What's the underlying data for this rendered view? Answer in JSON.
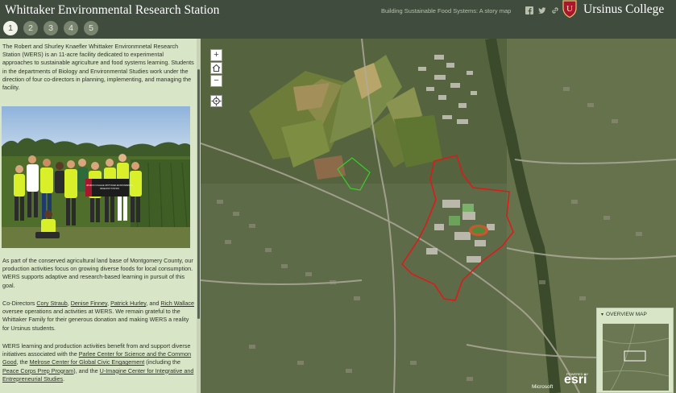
{
  "header": {
    "title": "Whittaker Environmental Research Station",
    "tabs": [
      "1",
      "2",
      "3",
      "4",
      "5"
    ],
    "active_tab": "1",
    "tagline": "Building Sustainable Food Systems: A story map",
    "share_icons": [
      "facebook-icon",
      "twitter-icon",
      "link-icon"
    ],
    "college_name": "Ursinus College"
  },
  "panel": {
    "intro": "The Robert and Shurley Knaefler Whittaker Environmnetal Research Station (WERS) is an 11-acre facility dedicated to experimental approaches to sustainable agriculture and food systems learning. Students in the departments of Biology and Environmental Studies work under the direction of four co-directors in planning, implementing, and managing the facility.",
    "photo_sign_line1": "URSINUS COLLEGE WHITTAKER ENVIRONMENTAL",
    "photo_sign_line2": "RESEARCH STATION",
    "para2": "As part of the conserved agricultural land base of Montgomery County, our production activities focus on growing diverse foods for local consumption. WERS supports adaptive and research-based learning in pursuit of this goal.",
    "para3": {
      "prefix": "Co-Directors ",
      "link1": "Cory Straub",
      "sep1": ", ",
      "link2": "Denise Finney",
      "sep2": ", ",
      "link3": "Patrick Hurley",
      "sep3": ", and ",
      "link4": "Rich Wallace",
      "suffix": " oversee operations and activities at WERS. We remain grateful to the Whittaker Family for their generous donation and making WERS a reality for Ursinus students."
    },
    "para4": {
      "prefix": "WERS learning and production activities benefit from and support diverse initiatives associated with the ",
      "link1": "Parlee Center for Science and the Common Good",
      "sep1": ", the ",
      "link2": "Melrose Center for Global Civic Engagement",
      "sep2": " (including the ",
      "link3": "Peace Corps Prep Program",
      "sep3": "), and the ",
      "link4": "U-Imagine Center for Integrative and Entrepreneurial Studies",
      "suffix": "."
    }
  },
  "map": {
    "zoom_in": "+",
    "zoom_out": "−",
    "home_icon": "home-icon",
    "locate_icon": "locate-icon",
    "overview_title": "OVERVIEW MAP",
    "attribution": "Microsoft",
    "powered_by": "POWERED BY",
    "esri_logo": "esri"
  },
  "colors": {
    "header_bg": "#3f4c3e",
    "panel_bg": "#d9e5c7",
    "green_boundary": "#38d02c",
    "red_boundary": "#e01818",
    "brand_red": "#a8182c"
  }
}
